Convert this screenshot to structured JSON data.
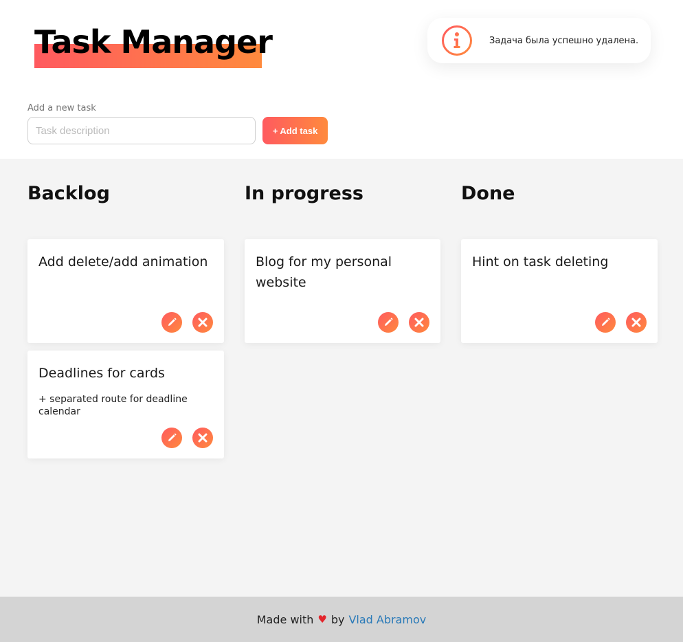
{
  "header": {
    "title": "Task Manager",
    "toast": {
      "icon": "info-icon",
      "message": "Задача была успешно удалена."
    }
  },
  "form": {
    "label": "Add a new task",
    "placeholder": "Task description",
    "value": "",
    "add_button_label": "+ Add task"
  },
  "columns": [
    {
      "title": "Backlog",
      "cards": [
        {
          "title": "Add delete/add animation",
          "description": ""
        },
        {
          "title": "Deadlines for cards",
          "description": "+ separated route for deadline calendar"
        }
      ]
    },
    {
      "title": "In progress",
      "cards": [
        {
          "title": "Blog for my personal website",
          "description": ""
        }
      ]
    },
    {
      "title": "Done",
      "cards": [
        {
          "title": "Hint on task deleting",
          "description": ""
        }
      ]
    }
  ],
  "card_actions": {
    "edit_icon": "pencil-icon",
    "delete_icon": "close-icon"
  },
  "footer": {
    "made_with": "Made with",
    "heart": "♥",
    "by": "by",
    "author": "Vlad Abramov"
  },
  "colors": {
    "accent_start": "#ff5a5f",
    "accent_end": "#ff8a3d",
    "link": "#2a7ab8",
    "heart": "#e3252c",
    "board_background": "#f4f4f4",
    "footer_background": "#d4d4d4"
  }
}
